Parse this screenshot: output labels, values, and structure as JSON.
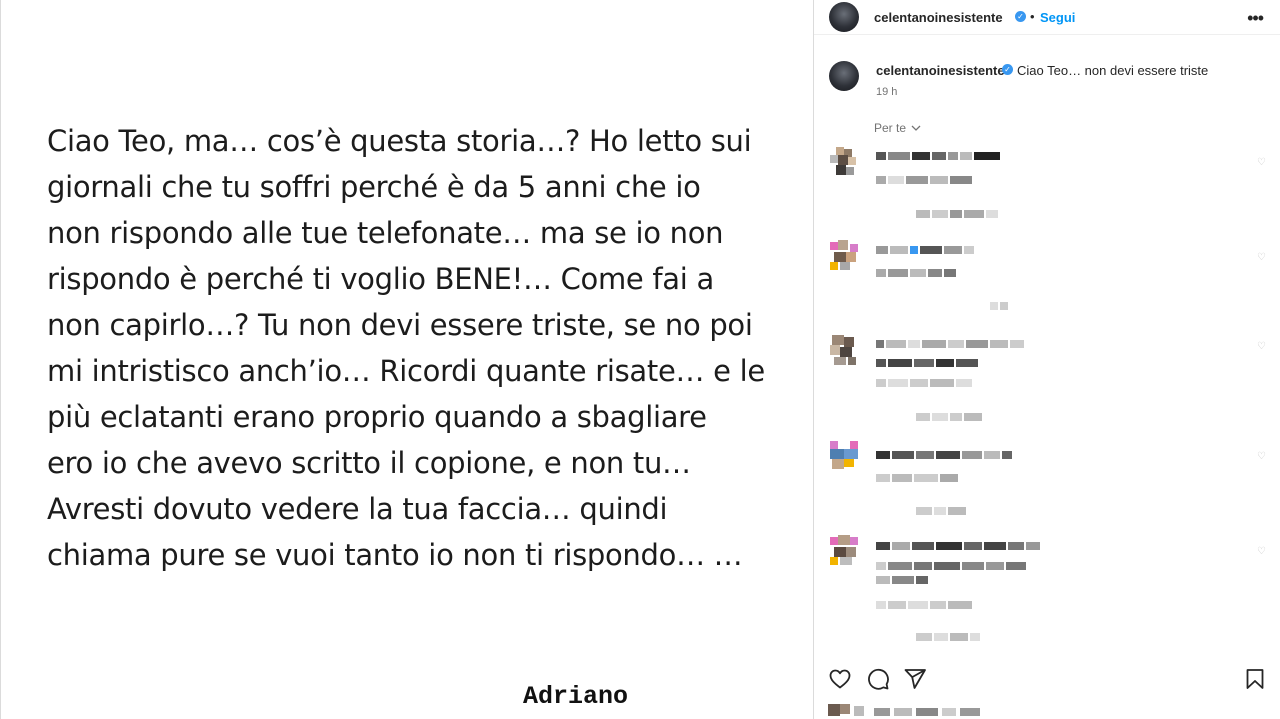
{
  "post": {
    "lines": [
      "Ciao Teo, ma… cos’è questa storia…? Ho letto sui",
      "giornali che tu soffri perché è da 5 anni che io",
      "non rispondo alle tue telefonate… ma se io non",
      "rispondo è perché ti voglio BENE!… Come fai a",
      "non capirlo…? Tu non devi essere triste, se no poi",
      "mi intristisco anch’io… Ricordi quante risate… e le",
      "più eclatanti erano proprio quando a sbagliare",
      "ero io che avevo scritto il copione, e non tu…",
      "Avresti dovuto vedere la tua faccia… quindi",
      "chiama pure se vuoi tanto io non ti rispondo… …"
    ],
    "signature": "Adriano"
  },
  "header": {
    "username": "celentanoinesistente",
    "dot": "•",
    "follow_label": "Segui",
    "more_icon": "more-horizontal-icon"
  },
  "caption": {
    "username": "celentanoinesistente",
    "text": "Ciao Teo… non devi essere triste",
    "time": "19 h"
  },
  "comments_filter": {
    "label": "Per te"
  },
  "colors": {
    "accent": "#0095f6",
    "verified": "#3897f0",
    "muted": "#737373"
  }
}
